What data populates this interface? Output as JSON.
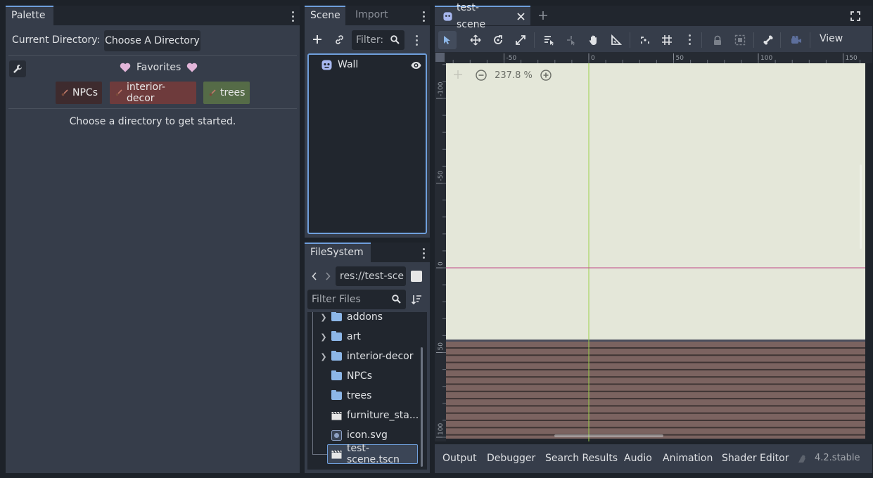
{
  "palette": {
    "tab": "Palette",
    "current_directory_label": "Current Directory:",
    "choose_button": "Choose A Directory",
    "favorites_label": "Favorites",
    "tags": [
      {
        "label": "NPCs",
        "color": "#3e2b2e"
      },
      {
        "label": "interior-decor",
        "color": "#6e3b3c"
      },
      {
        "label": "trees",
        "color": "#556b47"
      }
    ],
    "empty_message": "Choose a directory to get started."
  },
  "scene": {
    "tabs": [
      "Scene",
      "Import"
    ],
    "filter_placeholder": "Filter:",
    "nodes": [
      {
        "name": "Wall"
      }
    ]
  },
  "filesystem": {
    "tab": "FileSystem",
    "path": "res://test-sce",
    "filter_placeholder": "Filter Files",
    "items": [
      {
        "name": "addons",
        "type": "folder",
        "expandable": true
      },
      {
        "name": "art",
        "type": "folder",
        "expandable": true
      },
      {
        "name": "interior-decor",
        "type": "folder",
        "expandable": true
      },
      {
        "name": "NPCs",
        "type": "folder",
        "expandable": false
      },
      {
        "name": "trees",
        "type": "folder",
        "expandable": false
      },
      {
        "name": "furniture_sta...",
        "type": "scene",
        "expandable": false
      },
      {
        "name": "icon.svg",
        "type": "image",
        "expandable": false
      },
      {
        "name": "test-scene.tscn",
        "type": "scene",
        "expandable": false,
        "selected": true
      }
    ]
  },
  "viewport": {
    "scene_tab": "test-scene",
    "view_menu": "View",
    "zoom": "237.8 %",
    "ruler_top": [
      "-50",
      "0",
      "50",
      "100",
      "150"
    ],
    "ruler_left": [
      "-100",
      "-50",
      "0",
      "50",
      "100"
    ],
    "colors": {
      "canvas": "#e4e7d9",
      "floor": "#7b6360",
      "plank_line": "#3e3434"
    }
  },
  "bottom_panel": {
    "tabs": [
      "Output",
      "Debugger",
      "Search Results",
      "Audio",
      "Animation",
      "Shader Editor"
    ],
    "version": "4.2.stable"
  },
  "colors": {
    "accent": "#6f9fdc",
    "panel": "#363d4a",
    "background": "#1d2229"
  }
}
